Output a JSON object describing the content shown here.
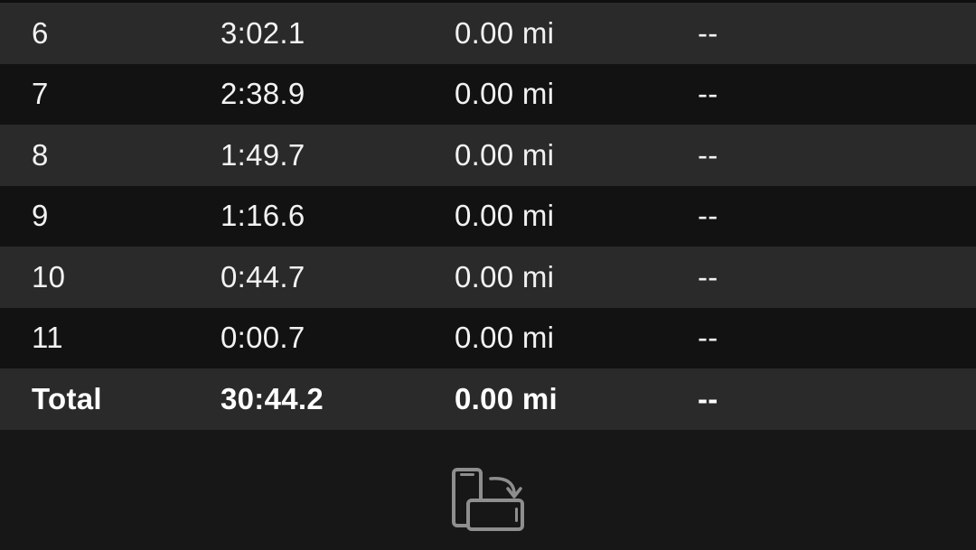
{
  "laps": [
    {
      "lap": "6",
      "time": "3:02.1",
      "distance": "0.00 mi",
      "pace": "--"
    },
    {
      "lap": "7",
      "time": "2:38.9",
      "distance": "0.00 mi",
      "pace": "--"
    },
    {
      "lap": "8",
      "time": "1:49.7",
      "distance": "0.00 mi",
      "pace": "--"
    },
    {
      "lap": "9",
      "time": "1:16.6",
      "distance": "0.00 mi",
      "pace": "--"
    },
    {
      "lap": "10",
      "time": "0:44.7",
      "distance": "0.00 mi",
      "pace": "--"
    },
    {
      "lap": "11",
      "time": "0:00.7",
      "distance": "0.00 mi",
      "pace": "--"
    }
  ],
  "total": {
    "label": "Total",
    "time": "30:44.2",
    "distance": "0.00 mi",
    "pace": "--"
  },
  "rotate_button": {
    "icon": "rotate-device-icon"
  },
  "colors": {
    "background": "#171717",
    "row_light": "#2a2a2a",
    "row_dark": "#121212",
    "icon": "#8e8e8e"
  }
}
